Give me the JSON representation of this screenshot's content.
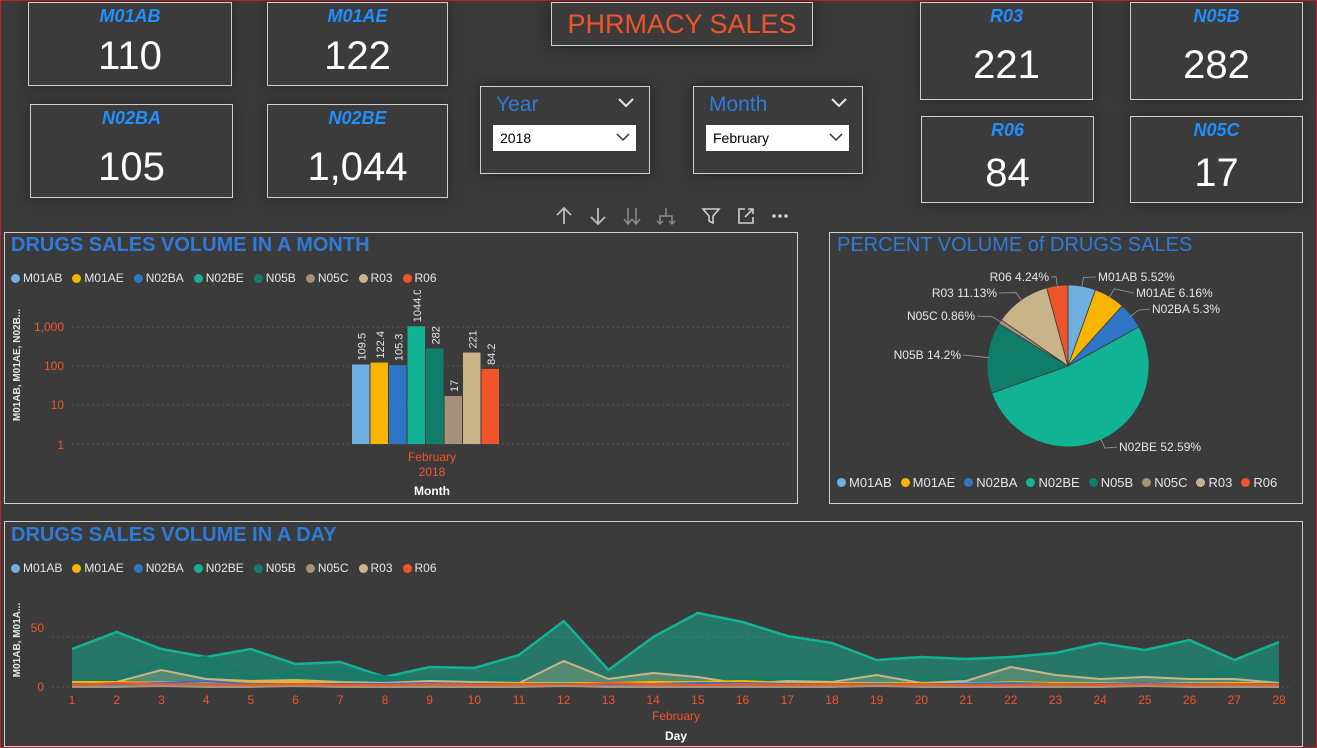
{
  "report_title": "PHRMACY SALES",
  "kpis": [
    {
      "label": "M01AB",
      "value": "110"
    },
    {
      "label": "M01AE",
      "value": "122"
    },
    {
      "label": "N02BA",
      "value": "105"
    },
    {
      "label": "N02BE",
      "value": "1,044"
    },
    {
      "label": "R03",
      "value": "221"
    },
    {
      "label": "N05B",
      "value": "282"
    },
    {
      "label": "R06",
      "value": "84"
    },
    {
      "label": "N05C",
      "value": "17"
    }
  ],
  "slicers": {
    "year": {
      "title": "Year",
      "selected": "2018"
    },
    "month": {
      "title": "Month",
      "selected": "February"
    }
  },
  "toolbar_icons": [
    "arrow-up-icon",
    "arrow-down-icon",
    "double-arrow-down-icon",
    "hierarchy-icon",
    "filter-icon",
    "focus-mode-icon",
    "more-options-icon"
  ],
  "series_names": [
    "M01AB",
    "M01AE",
    "N02BA",
    "N02BE",
    "N05B",
    "N05C",
    "R03",
    "R06"
  ],
  "series_colors": [
    "#70b0e0",
    "#f7b500",
    "#2e75c8",
    "#12b394",
    "#107d6b",
    "#a5907a",
    "#c9b48a",
    "#f0542a"
  ],
  "monthly_chart": {
    "title": "DRUGS SALES VOLUME IN A MONTH",
    "y_axis_label": "M01AB, M01AE, N02B...",
    "x_axis_label": "Month",
    "category_month": "February",
    "category_year": "2018",
    "y_ticks": [
      "1,000",
      "100",
      "10",
      "1"
    ]
  },
  "pie_chart": {
    "title": "PERCENT VOLUME of DRUGS SALES",
    "labels": [
      "M01AB 5.52%",
      "M01AE 6.16%",
      "N02BA 5.3%",
      "N02BE 52.59%",
      "N05B 14.2%",
      "N05C 0.86%",
      "R03 11.13%",
      "R06 4.24%"
    ]
  },
  "daily_chart": {
    "title": "DRUGS SALES VOLUME IN A DAY",
    "y_axis_label": "M01AB, M01A...",
    "x_axis_label": "Day",
    "month_label": "February",
    "y_ticks": [
      "50",
      "0"
    ]
  },
  "chart_data": [
    {
      "type": "bar",
      "title": "DRUGS SALES VOLUME IN A MONTH",
      "xlabel": "Month",
      "ylabel": "M01AB, M01AE, N02B...",
      "y_scale": "log",
      "ylim": [
        1,
        1000
      ],
      "categories": [
        "February 2018"
      ],
      "series": [
        {
          "name": "M01AB",
          "values": [
            109.5
          ]
        },
        {
          "name": "M01AE",
          "values": [
            122.4
          ]
        },
        {
          "name": "N02BA",
          "values": [
            105.3
          ]
        },
        {
          "name": "N02BE",
          "values": [
            1044.0
          ]
        },
        {
          "name": "N05B",
          "values": [
            282
          ]
        },
        {
          "name": "N05C",
          "values": [
            17
          ]
        },
        {
          "name": "R03",
          "values": [
            221
          ]
        },
        {
          "name": "R06",
          "values": [
            84.2
          ]
        }
      ],
      "data_labels": [
        "109.5",
        "122.4",
        "105.3",
        "1044.0",
        "282",
        "17",
        "221",
        "84.2"
      ],
      "legend": "top-left",
      "grid": true
    },
    {
      "type": "pie",
      "title": "PERCENT VOLUME of DRUGS SALES",
      "slices": [
        {
          "name": "M01AB",
          "percent": 5.52
        },
        {
          "name": "M01AE",
          "percent": 6.16
        },
        {
          "name": "N02BA",
          "percent": 5.3
        },
        {
          "name": "N02BE",
          "percent": 52.59
        },
        {
          "name": "N05B",
          "percent": 14.2
        },
        {
          "name": "N05C",
          "percent": 0.86
        },
        {
          "name": "R03",
          "percent": 11.13
        },
        {
          "name": "R06",
          "percent": 4.24
        }
      ],
      "legend": "bottom"
    },
    {
      "type": "area",
      "title": "DRUGS SALES VOLUME IN A DAY",
      "xlabel": "Day",
      "ylabel": "M01AB, M01A...",
      "ylim": [
        0,
        80
      ],
      "x": [
        1,
        2,
        3,
        4,
        5,
        6,
        7,
        8,
        9,
        10,
        11,
        12,
        13,
        14,
        15,
        16,
        17,
        18,
        19,
        20,
        21,
        22,
        23,
        24,
        25,
        26,
        27,
        28
      ],
      "series": [
        {
          "name": "M01AB",
          "values": [
            4,
            4,
            5,
            5,
            4,
            4,
            4,
            3,
            4,
            3,
            4,
            3,
            4,
            3,
            4,
            3,
            4,
            3,
            4,
            3,
            4,
            3,
            4,
            3,
            4,
            3,
            4,
            3
          ]
        },
        {
          "name": "M01AE",
          "values": [
            5,
            5,
            4,
            6,
            5,
            5,
            4,
            3,
            4,
            4,
            4,
            4,
            4,
            5,
            5,
            6,
            4,
            4,
            4,
            4,
            3,
            5,
            4,
            4,
            4,
            4,
            4,
            4
          ]
        },
        {
          "name": "N02BA",
          "values": [
            3,
            3,
            4,
            6,
            3,
            3,
            3,
            3,
            4,
            3,
            3,
            3,
            3,
            3,
            4,
            4,
            3,
            3,
            3,
            3,
            3,
            4,
            3,
            3,
            4,
            3,
            3,
            3
          ]
        },
        {
          "name": "N02BE",
          "values": [
            38,
            55,
            38,
            30,
            38,
            23,
            25,
            10,
            20,
            19,
            32,
            66,
            17,
            50,
            74,
            65,
            51,
            44,
            27,
            30,
            28,
            30,
            34,
            44,
            37,
            47,
            27,
            45
          ]
        },
        {
          "name": "N05B",
          "values": [
            5,
            7,
            25,
            30,
            10,
            15,
            18,
            10,
            8,
            7,
            9,
            10,
            8,
            8,
            10,
            8,
            9,
            8,
            8,
            7,
            8,
            9,
            8,
            9,
            8,
            7,
            20,
            22
          ]
        },
        {
          "name": "N05C",
          "values": [
            0,
            0,
            1,
            0,
            0,
            1,
            0,
            0,
            0,
            0,
            0,
            1,
            0,
            0,
            0,
            0,
            0,
            0,
            1,
            0,
            0,
            0,
            0,
            0,
            1,
            0,
            0,
            0
          ]
        },
        {
          "name": "R03",
          "values": [
            3,
            5,
            17,
            8,
            6,
            7,
            5,
            4,
            6,
            5,
            4,
            26,
            8,
            14,
            10,
            3,
            6,
            5,
            12,
            4,
            6,
            20,
            12,
            8,
            10,
            8,
            8,
            4
          ]
        },
        {
          "name": "R06",
          "values": [
            2,
            4,
            3,
            3,
            2,
            3,
            2,
            2,
            3,
            2,
            3,
            2,
            4,
            3,
            2,
            3,
            2,
            3,
            2,
            3,
            2,
            2,
            3,
            2,
            3,
            2,
            3,
            2
          ]
        }
      ],
      "x_month_label": "February",
      "legend": "top-left",
      "grid": true
    }
  ]
}
